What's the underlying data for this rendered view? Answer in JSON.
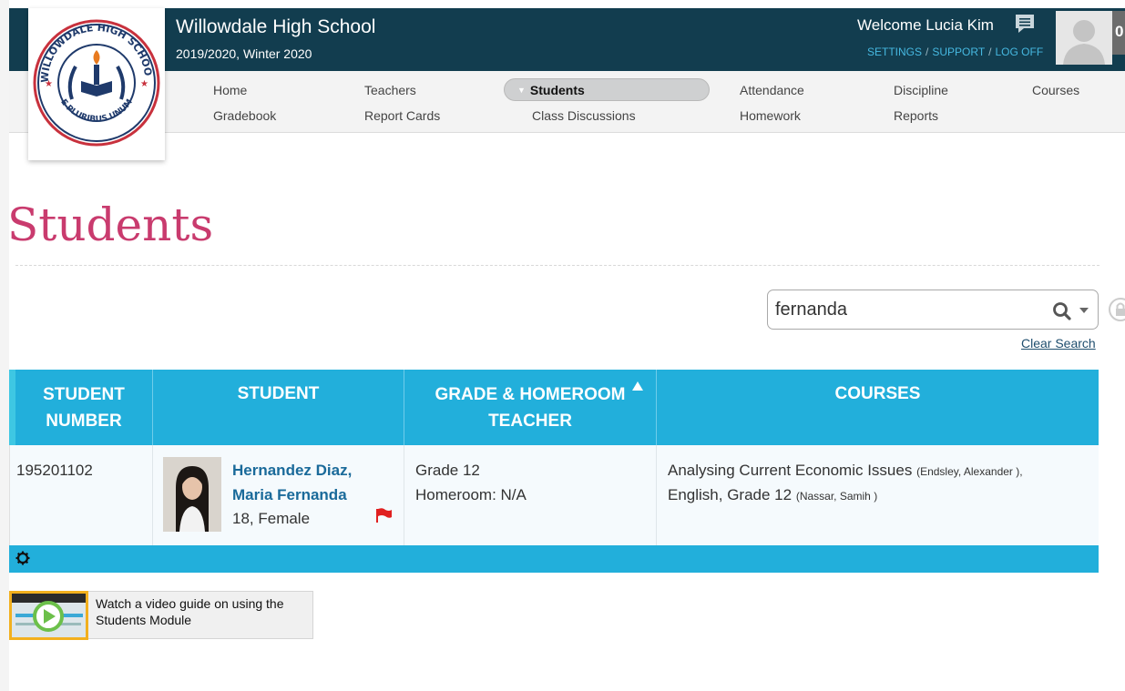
{
  "header": {
    "school_name": "Willowdale High School",
    "term": "2019/2020, Winter 2020",
    "welcome": "Welcome Lucia Kim",
    "links": {
      "settings": "SETTINGS",
      "support": "SUPPORT",
      "logoff": "LOG OFF"
    },
    "notification_count": "0"
  },
  "logo": {
    "ring_text_top": "WILLOWDALE HIGH SCHOOL",
    "ring_text_bottom": "E PLURIBUS UNUM"
  },
  "nav": {
    "row1": [
      "Home",
      "Teachers",
      "Students",
      "Attendance",
      "Discipline",
      "Courses"
    ],
    "row2": [
      "Gradebook",
      "Report Cards",
      "Class Discussions",
      "Homework",
      "Reports"
    ],
    "active": "Students"
  },
  "page": {
    "title": "Students"
  },
  "search": {
    "value": "fernanda",
    "clear_label": "Clear Search"
  },
  "table": {
    "headers": {
      "student_number": [
        "STUDENT",
        "NUMBER"
      ],
      "student": "STUDENT",
      "grade_homeroom": [
        "GRADE & HOMEROOM",
        "TEACHER"
      ],
      "courses": "COURSES"
    },
    "rows": [
      {
        "student_number": "195201102",
        "name_line1": "Hernandez Diaz,",
        "name_line2": "Maria Fernanda",
        "age_gender": "18, Female",
        "grade": "Grade 12",
        "homeroom": "Homeroom: N/A",
        "course1": "Analysing Current Economic Issues",
        "course1_teacher": "(Endsley, Alexander ),",
        "course2": "English, Grade  12",
        "course2_teacher": "(Nassar, Samih )"
      }
    ]
  },
  "video_guide": {
    "line1": "Watch a video guide on using the",
    "line2": "Students Module"
  },
  "colors": {
    "header_bg": "#123d4f",
    "table_blue": "#22afdb",
    "title_pink": "#c93b6e",
    "link_blue": "#1a6a9a"
  }
}
